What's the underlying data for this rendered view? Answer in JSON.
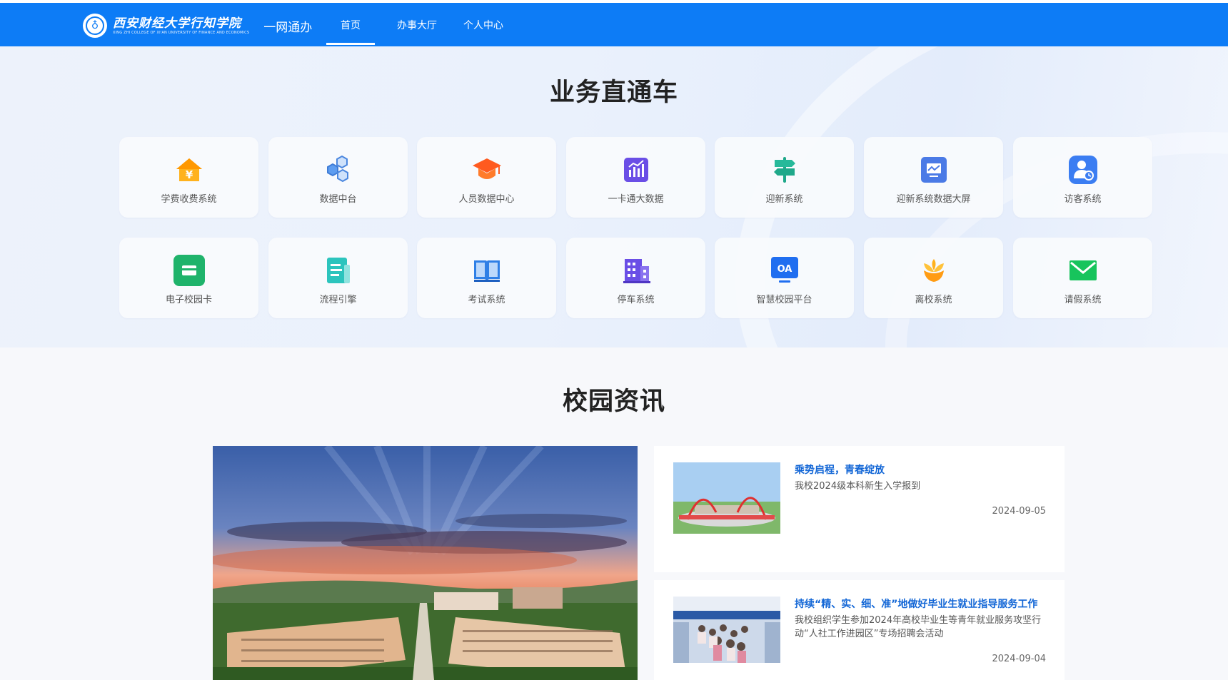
{
  "header": {
    "logo_text": "西安财经大学行知学院",
    "logo_sub": "XING ZHI COLLEGE OF XI'AN UNIVERSITY OF FINANCE AND ECONOMICS",
    "suffix": "一网通办",
    "nav": [
      {
        "label": "首页",
        "active": true
      },
      {
        "label": "办事大厅",
        "active": false
      },
      {
        "label": "个人中心",
        "active": false
      }
    ]
  },
  "services": {
    "title": "业务直通车",
    "items": [
      {
        "label": "学费收费系统",
        "icon": "tuition-house-icon"
      },
      {
        "label": "数据中台",
        "icon": "hexagons-icon"
      },
      {
        "label": "人员数据中心",
        "icon": "graduation-cap-icon"
      },
      {
        "label": "一卡通大数据",
        "icon": "bar-chart-icon"
      },
      {
        "label": "迎新系统",
        "icon": "signpost-icon"
      },
      {
        "label": "迎新系统数据大屏",
        "icon": "monitor-icon"
      },
      {
        "label": "访客系统",
        "icon": "visitor-icon"
      },
      {
        "label": "电子校园卡",
        "icon": "card-icon"
      },
      {
        "label": "流程引擎",
        "icon": "document-icon"
      },
      {
        "label": "考试系统",
        "icon": "book-icon"
      },
      {
        "label": "停车系统",
        "icon": "building-icon"
      },
      {
        "label": "智慧校园平台",
        "icon": "oa-icon",
        "badge": "OA"
      },
      {
        "label": "离校系统",
        "icon": "flower-icon"
      },
      {
        "label": "请假系统",
        "icon": "envelope-icon"
      }
    ]
  },
  "news": {
    "title": "校园资讯",
    "items": [
      {
        "title": "乘势启程，青春绽放",
        "desc": "我校2024级本科新生入学报到",
        "date": "2024-09-05"
      },
      {
        "title": "持续“精、实、细、准”地做好毕业生就业指导服务工作",
        "desc": "我校组织学生参加2024年高校毕业生等青年就业服务攻坚行动“人社工作进园区”专场招聘会活动",
        "date": "2024-09-04"
      }
    ]
  },
  "colors": {
    "brand": "#0d7cf6",
    "news_title": "#1266d6"
  }
}
